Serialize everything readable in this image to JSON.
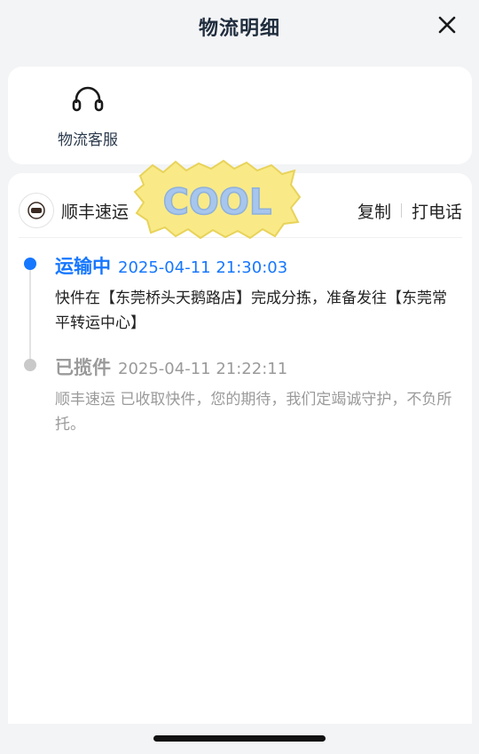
{
  "header": {
    "title": "物流明细",
    "close_icon": "close-icon"
  },
  "service": {
    "label": "物流客服",
    "icon": "headset-icon"
  },
  "carrier": {
    "name": "顺丰速运",
    "logo_icon": "sf-express-logo",
    "copy_label": "复制",
    "call_label": "打电话"
  },
  "sticker": {
    "text": "COOL"
  },
  "timeline": [
    {
      "status": "运输中",
      "time": "2025-04-11 21:30:03",
      "desc": "快件在【东莞桥头天鹅路店】完成分拣，准备发往【东莞常平转运中心】",
      "active": true
    },
    {
      "status": "已揽件",
      "time": "2025-04-11 21:22:11",
      "desc": "顺丰速运 已收取快件，您的期待，我们定竭诚守护，不负所托。",
      "active": false
    }
  ],
  "colors": {
    "accent": "#1677ff",
    "muted": "#9a9a9a",
    "title": "#1f2d3d"
  }
}
